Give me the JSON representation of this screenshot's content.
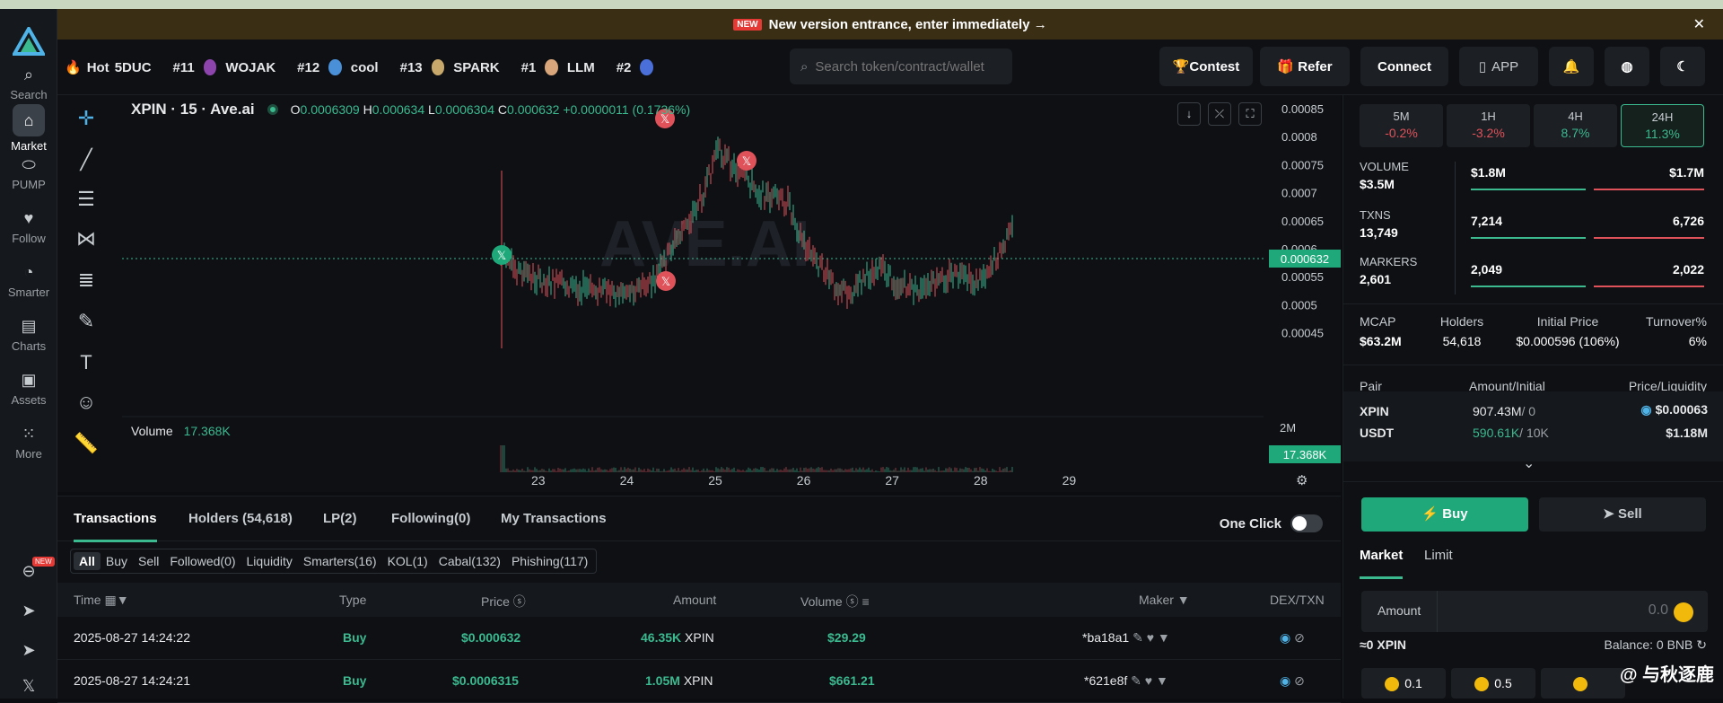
{
  "banner": {
    "new": "NEW",
    "text": "New version entrance, enter immediately →",
    "close": "✕"
  },
  "nav": {
    "items": [
      {
        "label": "Search",
        "icon": "search-icon"
      },
      {
        "label": "Market",
        "icon": "market-icon"
      },
      {
        "label": "PUMP",
        "icon": "pill-icon"
      },
      {
        "label": "Follow",
        "icon": "heart-icon"
      },
      {
        "label": "Smarter",
        "icon": "smarter-icon"
      },
      {
        "label": "Charts",
        "icon": "charts-icon"
      },
      {
        "label": "Assets",
        "icon": "wallet-icon"
      },
      {
        "label": "More",
        "icon": "grid-icon"
      }
    ],
    "new_badge": "NEW"
  },
  "ticker": [
    {
      "rank": "Hot",
      "name": "5DUC"
    },
    {
      "rank": "#11",
      "name": "WOJAK"
    },
    {
      "rank": "#12",
      "name": "cool"
    },
    {
      "rank": "#13",
      "name": "SPARK"
    },
    {
      "rank": "#1",
      "name": "LLM"
    },
    {
      "rank": "#2",
      "name": ""
    }
  ],
  "header": {
    "search_placeholder": "Search token/contract/wallet",
    "contest": "🏆Contest",
    "refer": "🎁 Refer",
    "connect": "Connect",
    "app": "APP"
  },
  "chart": {
    "title": "XPIN · 15 · Ave.ai",
    "o_label": "O",
    "o": "0.0006309",
    "h_label": "H",
    "h": "0.000634",
    "l_label": "L",
    "l": "0.0006304",
    "c_label": "C",
    "c": "0.000632",
    "change": "+0.0000011 (0.1736%)",
    "watermark": "AVE.AI",
    "volume_label": "Volume",
    "volume_value": "17.368K",
    "price_tag": "0.000632",
    "volume_tag": "17.368K",
    "vol_axis": "2M",
    "yticks": [
      "0.00085",
      "0.0008",
      "0.00075",
      "0.0007",
      "0.00065",
      "0.0006",
      "0.00055",
      "0.0005",
      "0.00045"
    ],
    "xticks": [
      "23",
      "24",
      "25",
      "26",
      "27",
      "28",
      "29"
    ]
  },
  "tabs": [
    "Transactions",
    "Holders (54,618)",
    "LP(2)",
    "Following(0)",
    "My Transactions"
  ],
  "one_click": "One Click",
  "filters": [
    "All",
    "Buy",
    "Sell",
    "Followed(0)",
    "Liquidity",
    "Smarters(16)",
    "KOL(1)",
    "Cabal(132)",
    "Phishing(117)"
  ],
  "table": {
    "headers": {
      "time": "Time",
      "type": "Type",
      "price": "Price",
      "amount": "Amount",
      "volume": "Volume",
      "maker": "Maker",
      "dex": "DEX/TXN"
    },
    "rows": [
      {
        "time": "2025-08-27 14:24:22",
        "type": "Buy",
        "price": "$0.000632",
        "amount": "46.35K",
        "token": "XPIN",
        "volume": "$29.29",
        "maker": "*ba18a1"
      },
      {
        "time": "2025-08-27 14:24:21",
        "type": "Buy",
        "price": "$0.0006315",
        "amount": "1.05M",
        "token": "XPIN",
        "volume": "$661.21",
        "maker": "*621e8f"
      }
    ]
  },
  "right": {
    "timeframes": [
      {
        "label": "5M",
        "value": "-0.2%",
        "color": "#e0525a"
      },
      {
        "label": "1H",
        "value": "-3.2%",
        "color": "#e0525a"
      },
      {
        "label": "4H",
        "value": "8.7%",
        "color": "#3bb98f"
      },
      {
        "label": "24H",
        "value": "11.3%",
        "color": "#3bb98f"
      }
    ],
    "volume": {
      "label": "VOLUME",
      "value": "$3.5M",
      "buy": "$1.8M",
      "sell": "$1.7M"
    },
    "txns": {
      "label": "TXNS",
      "value": "13,749",
      "buy": "7,214",
      "sell": "6,726"
    },
    "makers": {
      "label": "MARKERS",
      "value": "2,601",
      "buy": "2,049",
      "sell": "2,022"
    },
    "mcap": {
      "label": "MCAP",
      "value": "$63.2M"
    },
    "holders": {
      "label": "Holders",
      "value": "54,618"
    },
    "initial": {
      "label": "Initial Price",
      "value": "$0.000596 (106%)"
    },
    "turnover": {
      "label": "Turnover%",
      "value": "6%"
    },
    "pair_head": {
      "pair": "Pair",
      "amount": "Amount/Initial",
      "price": "Price/Liquidity"
    },
    "pair_rows": [
      {
        "token": "XPIN",
        "amount": "907.43M",
        "initial": "/ 0",
        "price": "$0.00063"
      },
      {
        "token": "USDT",
        "amount": "590.61K",
        "initial": "/ 10K",
        "price": "$1.18M"
      }
    ],
    "buy": "Buy",
    "sell": "Sell",
    "market": "Market",
    "limit": "Limit",
    "amount_label": "Amount",
    "amount_value": "0.0",
    "approx": "≈0 XPIN",
    "balance": "Balance: 0 BNB",
    "chips": [
      "0.1",
      "0.5",
      ""
    ],
    "watermark": "@ 与秋逐鹿"
  }
}
